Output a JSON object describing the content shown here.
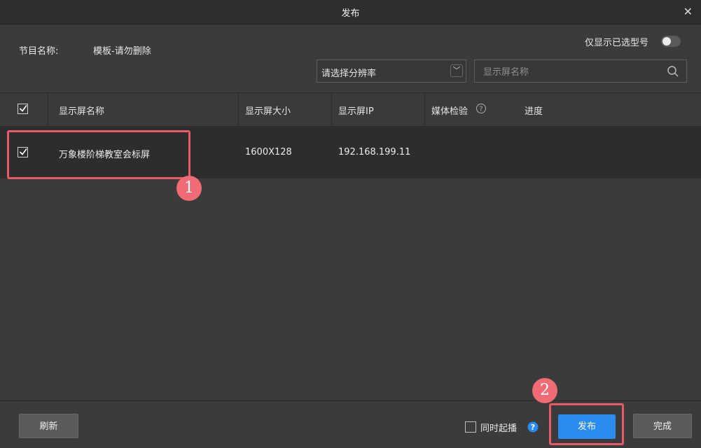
{
  "window": {
    "title": "发布"
  },
  "header": {
    "program_label": "节目名称:",
    "program_name": "模板-请勿删除",
    "only_selected_label": "仅显示已选型号"
  },
  "filters": {
    "resolution_value": "请选择分辨率",
    "search_placeholder": "显示屏名称"
  },
  "table": {
    "columns": [
      "显示屏名称",
      "显示屏大小",
      "显示屏IP",
      "媒体检验",
      "进度"
    ],
    "rows": [
      {
        "name": "万象楼阶梯教室会标屏",
        "size": "1600X128",
        "ip": "192.168.199.11",
        "checked": true
      }
    ]
  },
  "annotations": {
    "step1": "1",
    "step2": "2",
    "color": "#e85a66"
  },
  "footer": {
    "refresh_label": "刷新",
    "sync_play_label": "同时起播",
    "publish_label": "发布",
    "done_label": "完成"
  },
  "colors": {
    "accent": "#2b8cf0",
    "background": "#3b3b3b",
    "row_bg": "#2d2d2d"
  },
  "icons": [
    "close-icon",
    "search-icon",
    "chevron-down-icon",
    "help-circle-icon",
    "question-icon",
    "check-icon"
  ]
}
